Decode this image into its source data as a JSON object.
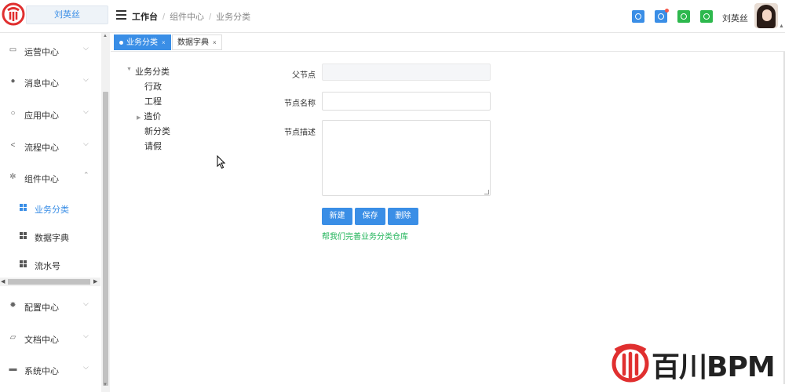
{
  "header": {
    "user_name_box": "刘英丝",
    "breadcrumbs": [
      "工作台",
      "组件中心",
      "业务分类"
    ],
    "user_name": "刘英丝",
    "icons": [
      {
        "name": "info-icon",
        "color": "#3a8ee6"
      },
      {
        "name": "bell-icon",
        "color": "#3a8ee6",
        "badge": true
      },
      {
        "name": "message-icon",
        "color": "#2db84d"
      },
      {
        "name": "lock-icon",
        "color": "#2db84d"
      }
    ]
  },
  "sidebar": {
    "items": [
      {
        "label": "运营中心",
        "icon": "monitor-icon",
        "expanded": false
      },
      {
        "label": "消息中心",
        "icon": "bell-icon",
        "expanded": false
      },
      {
        "label": "应用中心",
        "icon": "gear-icon",
        "expanded": false
      },
      {
        "label": "流程中心",
        "icon": "share-icon",
        "expanded": false
      },
      {
        "label": "组件中心",
        "icon": "cog-icon",
        "expanded": true
      },
      {
        "label": "配置中心",
        "icon": "settings-icon",
        "expanded": false
      },
      {
        "label": "文档中心",
        "icon": "folder-icon",
        "expanded": false
      },
      {
        "label": "系统中心",
        "icon": "desktop-icon",
        "expanded": false
      }
    ],
    "sub_items": [
      {
        "label": "业务分类",
        "active": true
      },
      {
        "label": "数据字典",
        "active": false
      },
      {
        "label": "流水号",
        "active": false
      }
    ]
  },
  "tabs": [
    {
      "label": "业务分类",
      "active": true
    },
    {
      "label": "数据字典",
      "active": false
    }
  ],
  "tree": {
    "root": "业务分类",
    "children": [
      {
        "label": "行政",
        "has_children": false
      },
      {
        "label": "工程",
        "has_children": false
      },
      {
        "label": "造价",
        "has_children": true
      },
      {
        "label": "新分类",
        "has_children": false
      },
      {
        "label": "请假",
        "has_children": false
      }
    ]
  },
  "form": {
    "parent_label": "父节点",
    "parent_value": "",
    "name_label": "节点名称",
    "name_value": "",
    "desc_label": "节点描述",
    "desc_value": "",
    "buttons": {
      "new": "新建",
      "save": "保存",
      "delete": "删除"
    },
    "help_link": "帮我们完善业务分类仓库"
  },
  "watermark": {
    "text": "百川BPM",
    "brand_color": "#e02f2f"
  }
}
